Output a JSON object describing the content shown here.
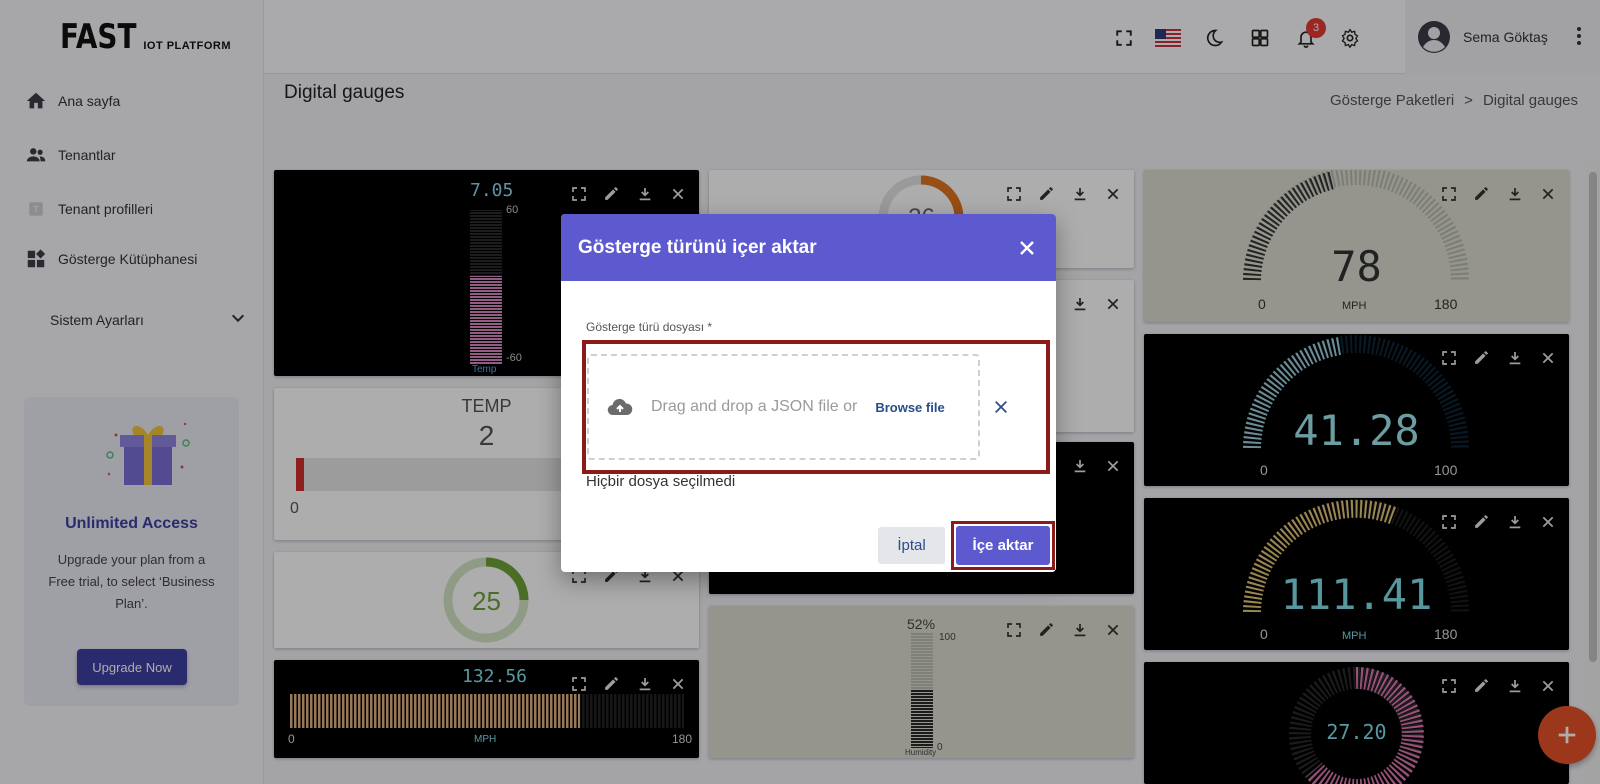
{
  "app": {
    "logo_big": "FAST",
    "logo_small": "IOT PLATFORM"
  },
  "sidebar": {
    "items": [
      {
        "label": "Ana sayfa",
        "icon": "home-icon"
      },
      {
        "label": "Tenantlar",
        "icon": "people-icon"
      },
      {
        "label": "Tenant profilleri",
        "icon": "tenant-profile-icon"
      },
      {
        "label": "Gösterge Kütüphanesi",
        "icon": "widgets-icon"
      }
    ],
    "system_settings": "Sistem Ayarları"
  },
  "promo": {
    "title": "Unlimited Access",
    "description": "Upgrade your plan from a Free trial, to select ‘Business Plan’.",
    "button": "Upgrade Now"
  },
  "header": {
    "notification_count": "3",
    "user_name": "Sema Göktaş",
    "icons": [
      "fullscreen-icon",
      "us-flag-icon",
      "dark-mode-icon",
      "apps-grid-icon",
      "bell-icon",
      "gear-icon",
      "avatar-icon",
      "more-vert-icon"
    ]
  },
  "page": {
    "title": "Digital gauges",
    "breadcrumb": [
      "Gösterge Paketleri",
      ">",
      "Digital gauges"
    ]
  },
  "cards": {
    "c1": {
      "value": "7.05",
      "max": "60",
      "min": "-60",
      "label": "Temp"
    },
    "c2": {
      "title": "TEMP",
      "value": "2",
      "min": "0"
    },
    "c3": {
      "value": "25"
    },
    "c4": {
      "value": "132.56",
      "min": "0",
      "max": "180",
      "unit": "MPH"
    },
    "c5": {
      "value": "26"
    },
    "c8": {
      "value": "52%",
      "max": "100",
      "min": "0",
      "label": "Humidity"
    },
    "c9": {
      "value": "78",
      "min": "0",
      "max": "180",
      "unit": "MPH"
    },
    "c10": {
      "value": "41.28",
      "min": "0",
      "max": "100"
    },
    "c11": {
      "value": "111.41",
      "min": "0",
      "max": "180",
      "unit": "MPH"
    },
    "c12": {
      "value": "27.20"
    }
  },
  "modal": {
    "title": "Gösterge türünü içer aktar",
    "field_label": "Gösterge türü dosyası *",
    "dropzone_text": "Drag and drop a JSON file or",
    "browse_label": "Browse file",
    "file_status": "Hiçbir dosya seçilmedi",
    "cancel": "İptal",
    "import": "İçe aktar"
  },
  "colors": {
    "modal_header": "#5d5ad0",
    "primary_button": "#5d5ad0",
    "highlight_outline": "#8b1a1a",
    "fab": "#e8522a",
    "promo_accent": "#3f3fa3"
  }
}
